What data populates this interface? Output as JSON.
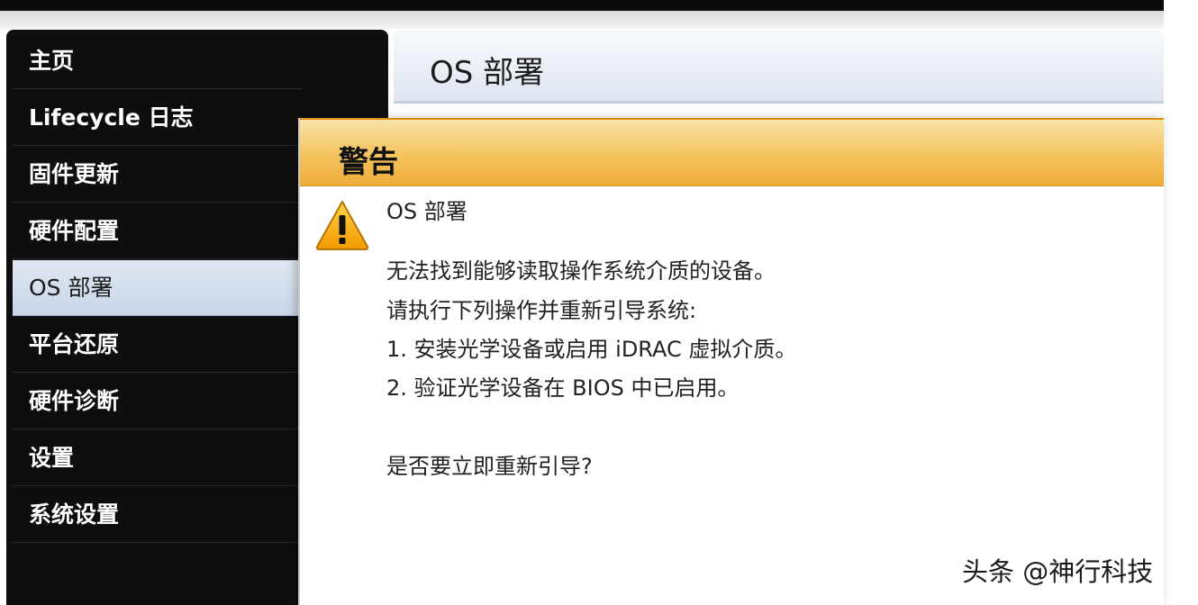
{
  "sidebar": {
    "items": [
      {
        "label": "主页"
      },
      {
        "label": "Lifecycle 日志"
      },
      {
        "label": "固件更新"
      },
      {
        "label": "硬件配置"
      },
      {
        "label": "OS 部署"
      },
      {
        "label": "平台还原"
      },
      {
        "label": "硬件诊断"
      },
      {
        "label": "设置"
      },
      {
        "label": "系统设置"
      }
    ],
    "active_item": "OS 部署"
  },
  "main": {
    "title": "OS 部署"
  },
  "dialog": {
    "title": "警告",
    "icon": "warning-icon",
    "heading": "OS 部署",
    "lines": [
      "无法找到能够读取操作系统介质的设备。",
      "请执行下列操作并重新引导系统:",
      "1. 安装光学设备或启用 iDRAC 虚拟介质。",
      "2. 验证光学设备在 BIOS 中已启用。",
      "是否要立即重新引导?"
    ]
  },
  "watermark": "头条 @神行科技",
  "colors": {
    "sidebar_bg": "#0e0e0e",
    "active_item_bg": "#c9d6e8",
    "dialog_header": "#f4c35e",
    "warning_icon": "#f2a100"
  }
}
